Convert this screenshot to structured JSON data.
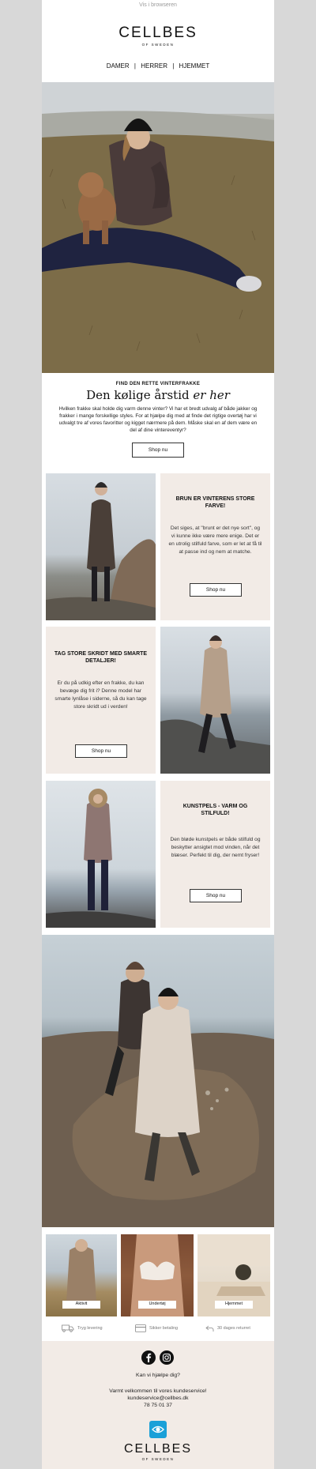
{
  "header": {
    "browser_link": "Vis i browseren",
    "brand_name": "CELLBES",
    "brand_sub": "OF SWEDEN",
    "nav": [
      "DAMER",
      "HERRER",
      "HJEMMET"
    ],
    "nav_separator": "|"
  },
  "intro": {
    "kicker": "FIND DEN RETTE VINTERFRAKKE",
    "title_plain": "Den kølige årstid",
    "title_italic": "er her",
    "body": "Hvilken frakke skal holde dig varm denne vinter? Vi har et bredt udvalg af både jakker og frakker i mange forskellige styles. For at hjælpe dig med at finde det rigtige overtøj har vi udvalgt tre af vores favoritter og kigget nærmere på dem. Måske skal en af dem være en del af dine vintereventyr?",
    "cta": "Shop nu"
  },
  "tiles": [
    {
      "title": "BRUN ER VINTERENS STORE FARVE!",
      "body": "Det siges, at \"brunt er det nye sort\", og vi kunne ikke være mere enige. Det er en utrolig stilfuld farve, som er let at få til at passe ind og nem at matche.",
      "cta": "Shop nu"
    },
    {
      "title": "TAG STORE SKRIDT MED SMARTE DETALJER!",
      "body": "Er du på udkig efter en frakke, du kan bevæge dig frit i? Denne model har smarte lynlåse i siderne, så du kan tage store skridt ud i verden!",
      "cta": "Shop nu"
    },
    {
      "title": "KUNSTPELS - VARM OG STILFULD!",
      "body": "Den bløde kunstpels er både stilfuld og beskytter ansigtet mod vinden, når det blæser. Perfekt til dig, der nemt fryser!",
      "cta": "Shop nu"
    }
  ],
  "categories": [
    "Aktivit",
    "Undertøj",
    "Hjemmet"
  ],
  "usps": [
    "Tryg levering",
    "Sikker betaling",
    "30 dages returret"
  ],
  "footer": {
    "help": "Kan vi hjælpe dig?",
    "welcome": "Varmt velkommen til vores kundeservice!",
    "email": "kundeservice@cellbes.dk",
    "phone": "78 75 01 37",
    "brand_name": "CELLBES",
    "brand_sub": "OF SWEDEN"
  },
  "colors": {
    "page_bg": "#d8d8d8",
    "tile_bg": "#f2ebe6",
    "footer_bg": "#f2ebe6",
    "text": "#222222",
    "accent_icon": "#1aa0d8"
  },
  "icons": [
    "truck-icon",
    "card-icon",
    "return-arrow-icon",
    "facebook-icon",
    "instagram-icon",
    "eye-logo-icon"
  ]
}
